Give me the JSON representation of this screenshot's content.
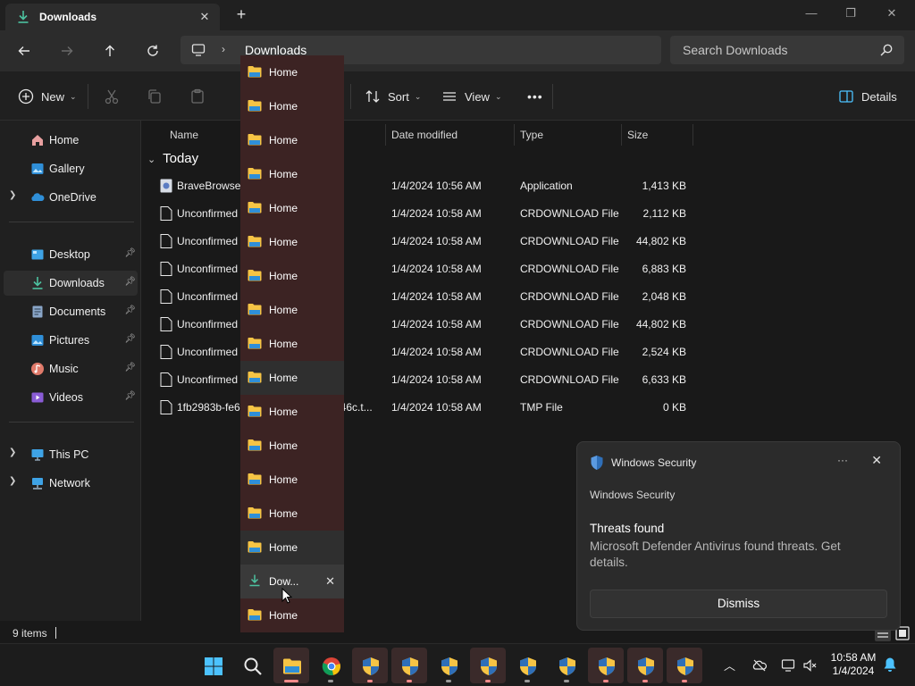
{
  "window": {
    "tab_title": "Downloads",
    "new_tab": "+",
    "tab_close": "✕",
    "minimize": "—",
    "maximize": "❐",
    "close": "✕"
  },
  "address": {
    "crumb": "Downloads",
    "search_placeholder": "Search Downloads"
  },
  "toolbar": {
    "new_label": "New",
    "sort_label": "Sort",
    "view_label": "View",
    "more_label": "•••",
    "details_label": "Details"
  },
  "sidebar": {
    "items": [
      {
        "label": "Home",
        "icon": "home-icon"
      },
      {
        "label": "Gallery",
        "icon": "gallery-icon"
      },
      {
        "label": "OneDrive",
        "icon": "onedrive-icon"
      },
      {
        "label": "Desktop",
        "icon": "desktop-icon"
      },
      {
        "label": "Downloads",
        "icon": "download-icon"
      },
      {
        "label": "Documents",
        "icon": "documents-icon"
      },
      {
        "label": "Pictures",
        "icon": "pictures-icon"
      },
      {
        "label": "Music",
        "icon": "music-icon"
      },
      {
        "label": "Videos",
        "icon": "videos-icon"
      },
      {
        "label": "This PC",
        "icon": "pc-icon"
      },
      {
        "label": "Network",
        "icon": "network-icon"
      }
    ]
  },
  "columns": {
    "name": "Name",
    "date": "Date modified",
    "type": "Type",
    "size": "Size"
  },
  "group": {
    "label": "Today"
  },
  "files": [
    {
      "name": "BraveBrowser",
      "name_tail": "",
      "date": "1/4/2024 10:56 AM",
      "type": "Application",
      "size": "1,413 KB"
    },
    {
      "name": "Unconfirmed",
      "name_tail": "",
      "date": "1/4/2024 10:58 AM",
      "type": "CRDOWNLOAD File",
      "size": "2,112 KB"
    },
    {
      "name": "Unconfirmed",
      "name_tail": "",
      "date": "1/4/2024 10:58 AM",
      "type": "CRDOWNLOAD File",
      "size": "44,802 KB"
    },
    {
      "name": "Unconfirmed",
      "name_tail": "",
      "date": "1/4/2024 10:58 AM",
      "type": "CRDOWNLOAD File",
      "size": "6,883 KB"
    },
    {
      "name": "Unconfirmed",
      "name_tail": "",
      "date": "1/4/2024 10:58 AM",
      "type": "CRDOWNLOAD File",
      "size": "2,048 KB"
    },
    {
      "name": "Unconfirmed",
      "name_tail": "",
      "date": "1/4/2024 10:58 AM",
      "type": "CRDOWNLOAD File",
      "size": "44,802 KB"
    },
    {
      "name": "Unconfirmed",
      "name_tail": "",
      "date": "1/4/2024 10:58 AM",
      "type": "CRDOWNLOAD File",
      "size": "2,524 KB"
    },
    {
      "name": "Unconfirmed",
      "name_tail": "",
      "date": "1/4/2024 10:58 AM",
      "type": "CRDOWNLOAD File",
      "size": "6,633 KB"
    },
    {
      "name": "1fb2983b-fe6",
      "name_tail": "746c.t...",
      "date": "1/4/2024 10:58 AM",
      "type": "TMP File",
      "size": "0 KB"
    }
  ],
  "status": {
    "count": "9 items"
  },
  "overflow": {
    "items": [
      {
        "label": "Home"
      },
      {
        "label": "Home"
      },
      {
        "label": "Home"
      },
      {
        "label": "Home"
      },
      {
        "label": "Home"
      },
      {
        "label": "Home"
      },
      {
        "label": "Home"
      },
      {
        "label": "Home"
      },
      {
        "label": "Home"
      },
      {
        "label": "Home"
      },
      {
        "label": "Home"
      },
      {
        "label": "Home"
      },
      {
        "label": "Home"
      },
      {
        "label": "Home"
      },
      {
        "label": "Home"
      },
      {
        "label": "Dow..."
      },
      {
        "label": "Home"
      }
    ],
    "close": "✕"
  },
  "toast": {
    "app_name": "Windows Security",
    "more": "···",
    "close": "✕",
    "subtitle": "Windows Security",
    "title": "Threats found",
    "body": "Microsoft Defender Antivirus found threats. Get details.",
    "dismiss": "Dismiss"
  },
  "clock": {
    "time": "10:58 AM",
    "date": "1/4/2024"
  },
  "colors": {
    "accent": "#4cc2ff",
    "folder": "#f6c445",
    "overflow_bg": "#3c2323"
  }
}
